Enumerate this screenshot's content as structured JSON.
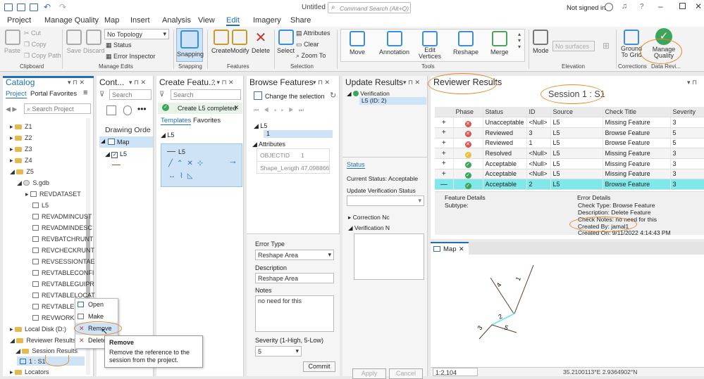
{
  "app": {
    "title": "Untitled",
    "search_placeholder": "Command Search (Alt+Q)",
    "signin": "Not signed in"
  },
  "menu": [
    "Project",
    "Manage Quality",
    "Map",
    "Insert",
    "Analysis",
    "View",
    "Edit",
    "Imagery",
    "Share"
  ],
  "ribbon": {
    "clipboard": {
      "paste": "Paste",
      "cut": "Cut",
      "copy": "Copy",
      "copy_path": "Copy Path",
      "label": "Clipboard"
    },
    "manage_edits": {
      "save": "Save",
      "discard": "Discard",
      "topology": "No Topology",
      "status": "Status",
      "inspector": "Error Inspector",
      "label": "Manage Edits"
    },
    "snapping": {
      "btn": "Snapping",
      "label": "Snapping"
    },
    "features": {
      "create": "Create",
      "modify": "Modify",
      "delete": "Delete",
      "label": "Features"
    },
    "selection": {
      "select": "Select",
      "attributes": "Attributes",
      "clear": "Clear",
      "zoom": "Zoom To",
      "label": "Selection"
    },
    "tools": {
      "move": "Move",
      "annotation": "Annotation",
      "edit_vertices": "Edit Vertices",
      "reshape": "Reshape",
      "merge": "Merge",
      "label": "Tools"
    },
    "elevation": {
      "mode": "Mode",
      "surfaces": "No surfaces",
      "label": "Elevation"
    },
    "corrections": {
      "ground": "Ground To Grid",
      "label": "Corrections"
    },
    "dr": {
      "manage": "Manage Quality",
      "label": "Data Revi..."
    }
  },
  "catalog": {
    "title": "Catalog",
    "tabs": [
      "Project",
      "Portal",
      "Favorites"
    ],
    "search_placeholder": "Search Project",
    "items": [
      "Z1",
      "Z2",
      "Z3",
      "Z4",
      "Z5",
      "S.gdb",
      "REVDATASET",
      "L5",
      "REVADMINCUST",
      "REVADMINDESC",
      "REVBATCHRUNT",
      "REVCHECKRUNT",
      "REVSESSIONTAE",
      "REVTABLECONFI",
      "REVTABLEGUIPR",
      "REVTABLELOCAT",
      "REVTABLEM",
      "REVWORKSP",
      "Local Disk (D:)",
      "Reviewer Results",
      "Session Results",
      "1 : S1",
      "Locators"
    ]
  },
  "context_menu": {
    "items": [
      "Open",
      "Make Default",
      "Remove",
      "Delete"
    ],
    "tip_title": "Remove",
    "tip_text": "Remove the reference to the session from the project."
  },
  "contents": {
    "title": "Cont...",
    "search_placeholder": "Search",
    "heading": "Drawing Orde",
    "map": "Map",
    "layer": "L5"
  },
  "create_features": {
    "title": "Create Featu...",
    "search_placeholder": "Search",
    "notice": "Create L5 completed",
    "tabs": [
      "Templates",
      "Favorites"
    ],
    "group": "L5",
    "template": "L5"
  },
  "browse": {
    "title": "Browse Features",
    "change": "Change the selection",
    "layer": "L5",
    "id": "1",
    "attributes_label": "Attributes",
    "attrs": [
      {
        "k": "OBJECTID",
        "v": "1"
      },
      {
        "k": "Shape_Length",
        "v": "47.098866"
      }
    ],
    "error_type_label": "Error Type",
    "error_type": "Reshape Area",
    "description_label": "Description",
    "description": "Reshape Area",
    "notes_label": "Notes",
    "notes": "no need for this",
    "severity_label": "Severity (1-High, 5-Low)",
    "severity": "5",
    "commit": "Commit"
  },
  "update": {
    "title": "Update Results",
    "verification": "Verification",
    "item": "L5 (ID: 2)",
    "status_tab": "Status",
    "current": "Current Status: Acceptable",
    "update_label": "Update Verification Status",
    "correction": "Correction Nc",
    "verification_n": "Verification N",
    "apply": "Apply",
    "cancel": "Cancel"
  },
  "reviewer": {
    "title": "Reviewer Results",
    "session": "Session 1 : S1",
    "columns": [
      "Phase",
      "Status",
      "ID",
      "Source",
      "Check Title",
      "Severity"
    ],
    "rows": [
      {
        "status": "Unacceptable",
        "id": "<Null>",
        "source": "L5",
        "check": "Missing Feature",
        "sev": "3",
        "icon": "red"
      },
      {
        "status": "Reviewed",
        "id": "3",
        "source": "L5",
        "check": "Browse Feature",
        "sev": "5",
        "icon": "red"
      },
      {
        "status": "Reviewed",
        "id": "1",
        "source": "L5",
        "check": "Browse Feature",
        "sev": "5",
        "icon": "red"
      },
      {
        "status": "Resolved",
        "id": "<Null>",
        "source": "L5",
        "check": "Missing Feature",
        "sev": "3",
        "icon": "yellow"
      },
      {
        "status": "Acceptable",
        "id": "<Null>",
        "source": "L5",
        "check": "Missing Feature",
        "sev": "3",
        "icon": "green"
      },
      {
        "status": "Acceptable",
        "id": "<Null>",
        "source": "L5",
        "check": "Missing Feature",
        "sev": "3",
        "icon": "green"
      },
      {
        "status": "Acceptable",
        "id": "2",
        "source": "L5",
        "check": "Browse Feature",
        "sev": "3",
        "icon": "green"
      }
    ],
    "feature_details": "Feature Details",
    "subtype": "Subtype:",
    "error_details": "Error Details",
    "details": [
      "Check Type:  Browse Feature",
      "Description:  Delete Feature",
      "Check Notes: no need for this",
      "Created By:  jamal1",
      "Created On:  9/11/2022 4:14:43 PM"
    ]
  },
  "map": {
    "tab": "Map",
    "labels": [
      "4",
      "1",
      "2",
      "3",
      "5"
    ],
    "scale": "1:2,104",
    "coords": "35.2100113°E 2.9364902°N"
  },
  "colors": {
    "accent": "#1f6fb5",
    "highlight": "#7fe8ea",
    "annotation": "#e8892a"
  }
}
